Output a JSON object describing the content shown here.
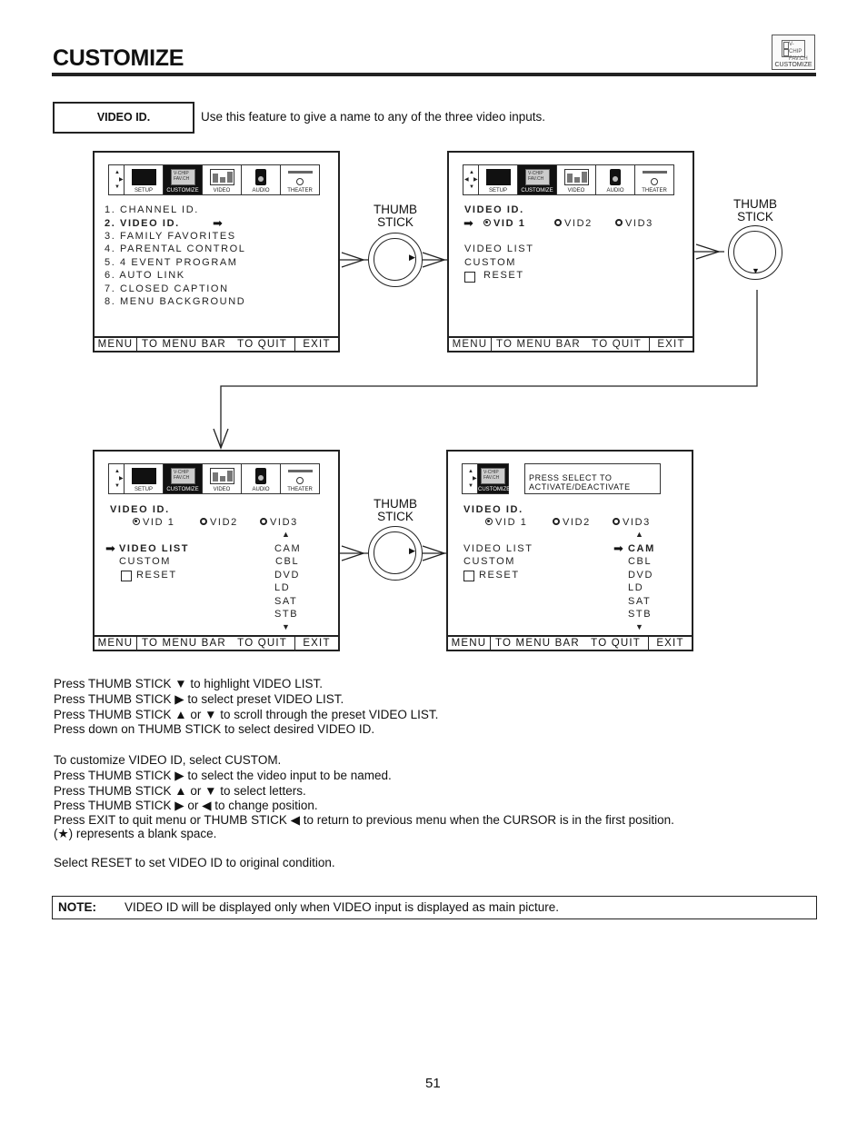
{
  "header": {
    "title": "CUSTOMIZE",
    "corner_icon": {
      "label": "CUSTOMIZE",
      "lines": [
        "V-CHIP",
        "FAV.CH"
      ]
    }
  },
  "feature": {
    "name": "VIDEO ID.",
    "description": "Use this feature to give a name to any of the three video inputs."
  },
  "tabs": [
    {
      "label": "SETUP",
      "icon": "tv-icon"
    },
    {
      "label": "CUSTOMIZE",
      "icon": "vchip-icon"
    },
    {
      "label": "VIDEO",
      "icon": "bar-graph-icon"
    },
    {
      "label": "AUDIO",
      "icon": "speaker-icon"
    },
    {
      "label": "THEATER",
      "icon": "theater-icon"
    }
  ],
  "menu_bar": {
    "menu": "MENU",
    "to_menu_bar": "TO MENU BAR",
    "to_quit": "TO QUIT",
    "exit": "EXIT"
  },
  "screen1": {
    "items": [
      "1. CHANNEL ID.",
      "2. VIDEO ID.",
      "3. FAMILY FAVORITES",
      "4. PARENTAL CONTROL",
      "5. 4 EVENT PROGRAM",
      "6. AUTO LINK",
      "7. CLOSED CAPTION",
      "8. MENU BACKGROUND"
    ],
    "selected_index": 1
  },
  "video_id": {
    "heading": "VIDEO ID.",
    "inputs": [
      "VID 1",
      "VID2",
      "VID3"
    ],
    "selected_input": "VID 1",
    "options": [
      "VIDEO LIST",
      "CUSTOM",
      "RESET"
    ],
    "video_list_label": "VIDEO  LIST",
    "preset_list": [
      "CAM",
      "CBL",
      "DVD",
      "LD",
      "SAT",
      "STB"
    ]
  },
  "screen4": {
    "hint_lines": [
      "PRESS SELECT TO",
      "ACTIVATE/DEACTIVATE"
    ],
    "highlighted_preset": "CAM"
  },
  "thumb_stick": {
    "label_line1": "THUMB",
    "label_line2": "STICK"
  },
  "instructions": {
    "block1": [
      "Press THUMB STICK ▼ to highlight VIDEO LIST.",
      "Press THUMB STICK ▶ to select preset VIDEO LIST.",
      "Press THUMB STICK ▲ or ▼ to scroll through the preset VIDEO LIST.",
      "Press down on THUMB STICK to select desired VIDEO ID."
    ],
    "block2": [
      "To customize VIDEO ID, select CUSTOM.",
      "Press THUMB STICK ▶ to select the video input to be named.",
      "Press THUMB STICK ▲ or ▼ to select letters.",
      "Press THUMB STICK ▶ or ◀ to change position.",
      "Press EXIT to quit menu or THUMB STICK ◀ to return to previous menu when the CURSOR is in the first position.",
      "(★) represents a blank space."
    ],
    "block3": "Select RESET to set VIDEO ID to original condition."
  },
  "note": {
    "label": "NOTE:",
    "text": "VIDEO ID will be displayed only when VIDEO input is displayed as main picture."
  },
  "page_number": "51"
}
